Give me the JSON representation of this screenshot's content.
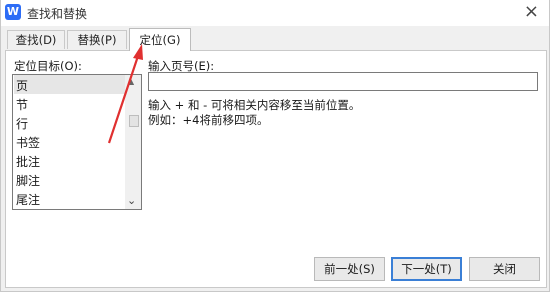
{
  "window": {
    "title": "查找和替换",
    "icon": "wps-writer-icon",
    "icon_letter": "W",
    "accent": "#2d6df6",
    "close_glyph": "×"
  },
  "tabs": [
    {
      "label": "查找(D)",
      "active": false
    },
    {
      "label": "替换(P)",
      "active": false
    },
    {
      "label": "定位(G)",
      "active": true
    }
  ],
  "goto": {
    "target_label": "定位目标(O):",
    "targets": [
      "页",
      "节",
      "行",
      "书签",
      "批注",
      "脚注",
      "尾注"
    ],
    "selected_target": "页",
    "page_label": "输入页号(E):",
    "page_value": "",
    "hint_line1": "输入 + 和 - 可将相关内容移至当前位置。",
    "hint_line2": "例如：+4将前移四项。"
  },
  "buttons": {
    "prev": "前一处(S)",
    "next": "下一处(T)",
    "close": "关闭"
  },
  "annotation": {
    "arrow_color": "#e03030"
  }
}
